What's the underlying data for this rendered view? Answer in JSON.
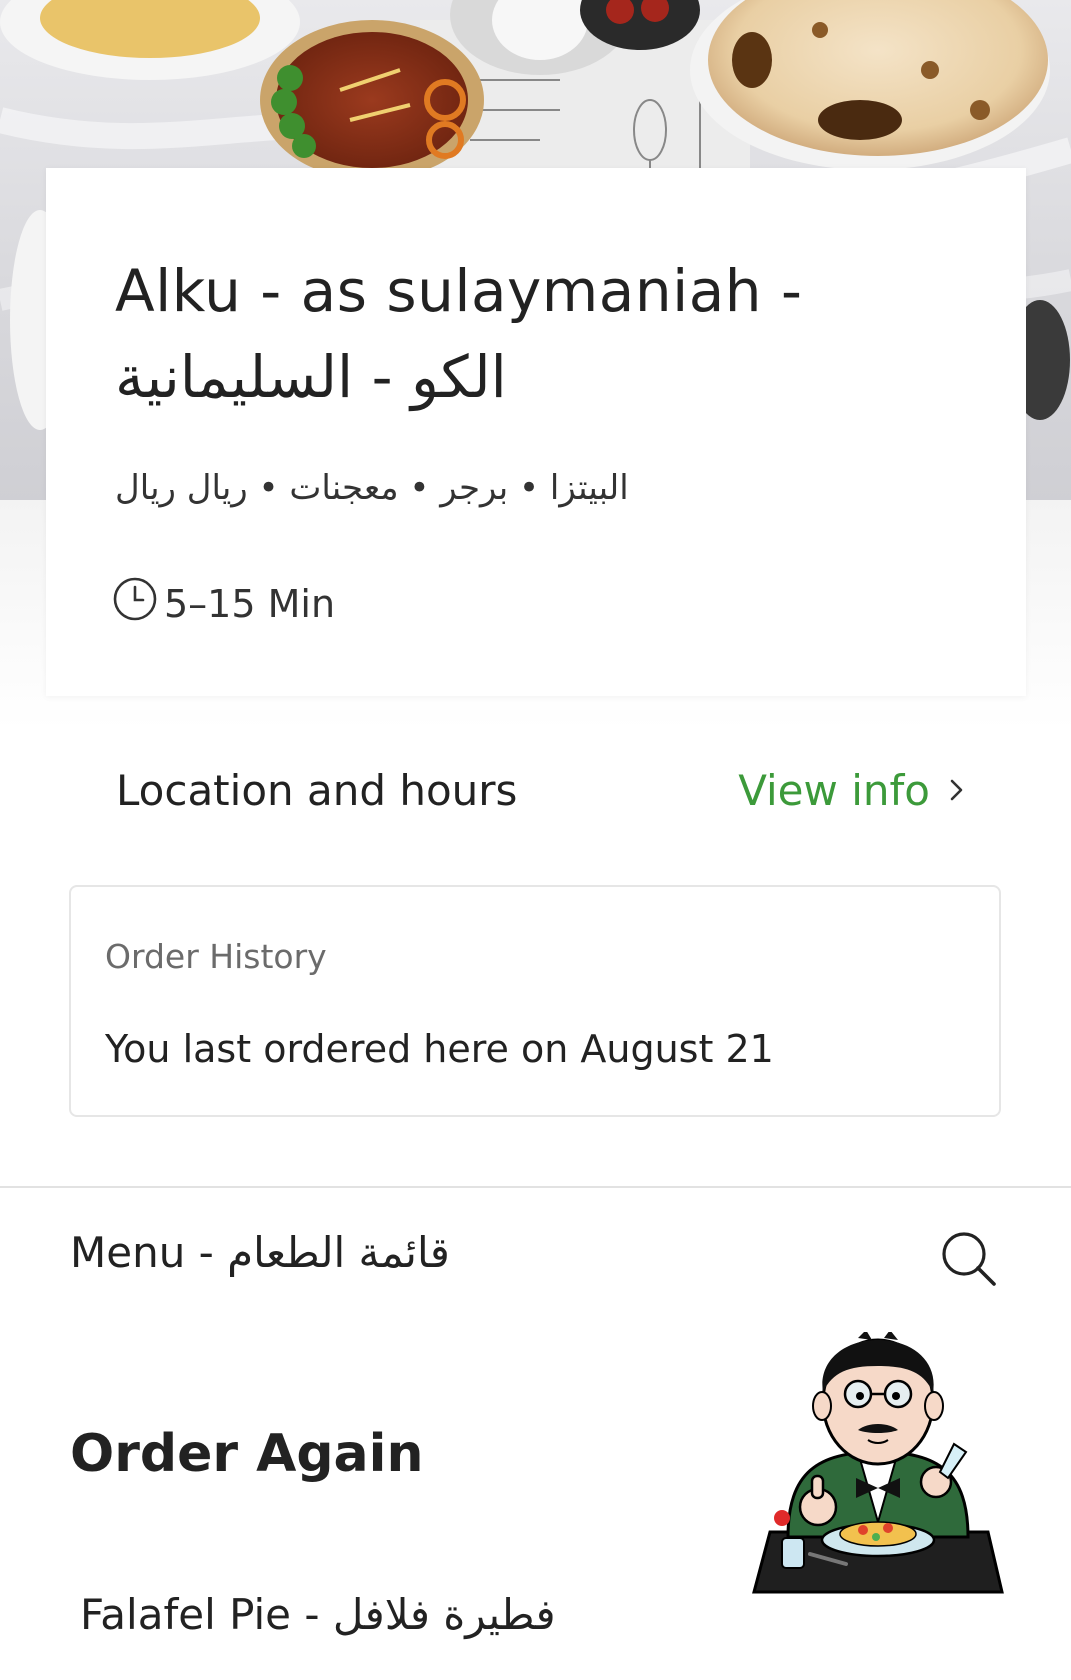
{
  "store": {
    "title_en": "Alku - as sulaymaniah -",
    "title_ar": "الكو - السليمانية",
    "categories": "البيتزا • برجر • معجنات • ريال ريال",
    "delivery_time": "5–15 Min"
  },
  "location": {
    "label": "Location and hours",
    "link_label": "View info"
  },
  "order_history": {
    "title": "Order History",
    "text": "You last ordered here on August 21"
  },
  "menu": {
    "label": "Menu - قائمة الطعام"
  },
  "order_again": {
    "title": "Order Again",
    "items": [
      {
        "name": "Falafel Pie - فطيرة فلافل"
      }
    ]
  },
  "icons": {
    "clock": "clock-icon",
    "chevron": "chevron-right-icon",
    "search": "search-icon",
    "mascot": "chef-mascot-illustration"
  },
  "colors": {
    "accent_green": "#3c9a3a",
    "text_primary": "#222222",
    "text_secondary": "#6b6b6b",
    "divider": "#e2e2e2"
  }
}
